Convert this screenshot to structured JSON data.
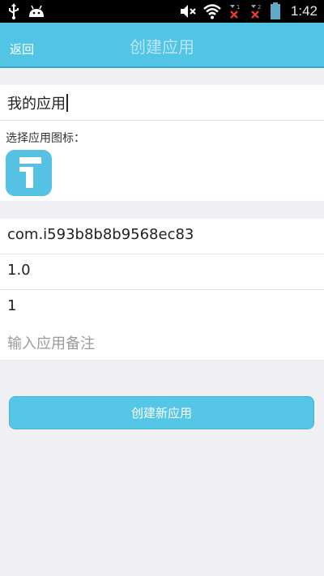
{
  "statusbar": {
    "time": "1:42",
    "icons": [
      "usb-icon",
      "android-icon",
      "mute-icon",
      "wifi-icon",
      "signal-1-icon",
      "signal-2-icon",
      "battery-icon"
    ],
    "signal_1_label": "1",
    "signal_2_label": "2"
  },
  "navbar": {
    "back_label": "返回",
    "title": "创建应用"
  },
  "form": {
    "app_name": "我的应用",
    "icon_label": "选择应用图标：",
    "package_name": "com.i593b8b8b9568ec83",
    "version_name": "1.0",
    "version_code": "1",
    "remark_placeholder": "输入应用备注"
  },
  "actions": {
    "create_label": "创建新应用"
  },
  "colors": {
    "accent": "#52c5e5",
    "background": "#efeff4",
    "status_error": "#e53935"
  }
}
